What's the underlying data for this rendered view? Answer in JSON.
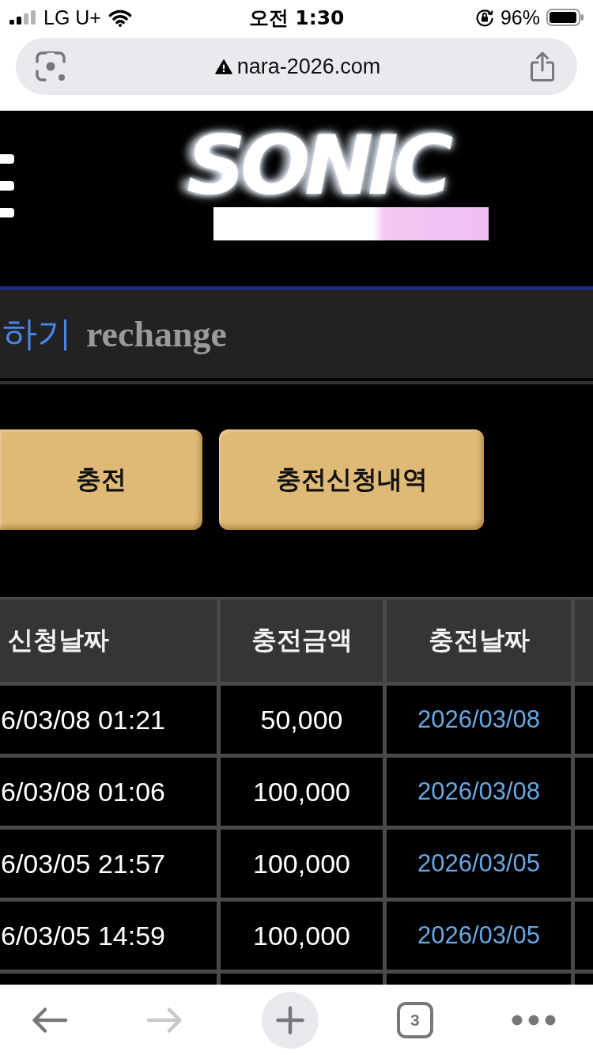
{
  "status_bar": {
    "carrier": "LG U+",
    "time": "오전 1:30",
    "battery": "96%"
  },
  "address_bar": {
    "url": "nara-2026.com",
    "insecure": true
  },
  "header": {
    "logo": "SONIC"
  },
  "title": {
    "text": "하기",
    "subtitle": "rechange"
  },
  "buttons": [
    {
      "label": "충전"
    },
    {
      "label": "충전신청내역"
    }
  ],
  "table": {
    "columns": [
      "신청날짜",
      "충전금액",
      "충전날짜"
    ],
    "rows": [
      {
        "requested_at": "6/03/08 01:21",
        "amount": "50,000",
        "charged_on": "2026/03/08"
      },
      {
        "requested_at": "6/03/08 01:06",
        "amount": "100,000",
        "charged_on": "2026/03/08"
      },
      {
        "requested_at": "6/03/05 21:57",
        "amount": "100,000",
        "charged_on": "2026/03/05"
      },
      {
        "requested_at": "6/03/05 14:59",
        "amount": "100,000",
        "charged_on": "2026/03/05"
      }
    ]
  },
  "toolbar": {
    "buttons": [
      {
        "kind": "back",
        "disabled": false
      },
      {
        "kind": "forward",
        "disabled": true
      },
      {
        "kind": "new_tab",
        "disabled": false
      },
      {
        "kind": "tabs",
        "disabled": false,
        "count": "3"
      },
      {
        "kind": "more",
        "disabled": false
      }
    ]
  }
}
